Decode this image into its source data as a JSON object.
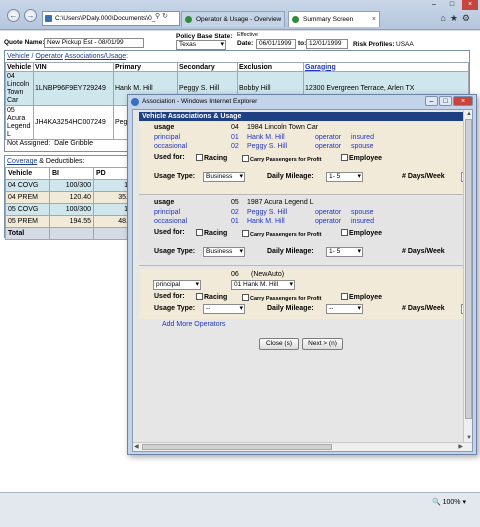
{
  "browser": {
    "address": "C:\\Users\\PDaly.000\\Documents\\0_",
    "tabs": [
      {
        "label": "Operator & Usage - Overview"
      },
      {
        "label": "Summary Screen"
      }
    ],
    "zoom": "100%"
  },
  "form": {
    "quote_name_label": "Quote Name:",
    "quote_name_value": "New Pickup Est - 08/01/99",
    "policy_base_state_label": "Policy Base State:",
    "policy_base_state_value": "Texas",
    "effective_label": "Effective",
    "date_label": "Date:",
    "date_from": "06/01/1999",
    "to_label": "to:",
    "date_to": "12/01/1999",
    "risk_profiles_label": "Risk Profiles:",
    "risk_profiles_value": "USAA"
  },
  "vehicle_panel": {
    "title_part1": "Vehicle",
    "title_sep1": " / ",
    "title_part2": "Operator",
    "title_part3": "Associations/Usage",
    "title_colon": ":",
    "headers": [
      "Vehicle",
      "VIN",
      "Primary",
      "Secondary",
      "Exclusion",
      "Garaging"
    ],
    "rows": [
      {
        "vehicle": "04 Lincoln Town Car",
        "vin": "1LNBP96F9EY729249",
        "primary": "Hank M. Hill",
        "secondary": "Peggy S. Hill",
        "exclusion": "Bobby Hill",
        "garaging": "12300 Evergreen Terrace, Arlen TX"
      },
      {
        "vehicle": "05 Acura Legend L",
        "vin": "JH4KA3254HC007249",
        "primary": "Peg"
      }
    ],
    "not_assigned_label": "Not Assigned:",
    "not_assigned_value": "Dale Gribble"
  },
  "coverage_panel": {
    "title_part1": "Coverage",
    "title_part2": " & Deductibles:",
    "headers": [
      "Vehicle",
      "BI",
      "PD"
    ],
    "rows": [
      {
        "vehicle": "04 COVG",
        "bi": "100/300",
        "pd": "1"
      },
      {
        "vehicle": "04 PREM",
        "bi": "120.40",
        "pd": "35."
      },
      {
        "vehicle": "05 COVG",
        "bi": "100/300",
        "pd": "1"
      },
      {
        "vehicle": "05 PREM",
        "bi": "194.55",
        "pd": "48."
      },
      {
        "vehicle": "Total",
        "bi": "",
        "pd": ""
      }
    ]
  },
  "dialog": {
    "title": "Association - Windows Internet Explorer",
    "header": "Vehicle Associations & Usage",
    "usage_word": "usage",
    "used_for_label": "Used for:",
    "racing_label": "Racing",
    "carry_label": "Carry Passengers for Profit",
    "employee_label": "Employee",
    "usage_type_label": "Usage Type:",
    "daily_mileage_label": "Daily Mileage:",
    "days_week_label": "# Days/Week",
    "blocks": [
      {
        "vehicle_num": "04",
        "vehicle_name": "1984 Lincoln Town Car",
        "ops": [
          {
            "role": "principal",
            "num": "01",
            "name": "Hank M. Hill",
            "type": "operator",
            "rel": "insured"
          },
          {
            "role": "occasional",
            "num": "02",
            "name": "Peggy S. Hill",
            "type": "operator",
            "rel": "spouse"
          }
        ],
        "usage_type": "Business",
        "daily_mileage": "1- 5"
      },
      {
        "vehicle_num": "05",
        "vehicle_name": "1987 Acura Legend L",
        "ops": [
          {
            "role": "principal",
            "num": "02",
            "name": "Peggy S. Hill",
            "type": "operator",
            "rel": "spouse"
          },
          {
            "role": "occasional",
            "num": "01",
            "name": "Hank M. Hill",
            "type": "operator",
            "rel": "insured"
          }
        ],
        "usage_type": "Business",
        "daily_mileage": "1- 5"
      },
      {
        "vehicle_num": "06",
        "vehicle_name": "(NewAuto)",
        "role_select": "principal",
        "operator_select": "01 Hank M. Hill",
        "usage_type": "--",
        "daily_mileage": "--"
      }
    ],
    "add_more_operators": "Add More Operators",
    "close_button": "Close (s)",
    "next_button": "Next > (n)"
  }
}
